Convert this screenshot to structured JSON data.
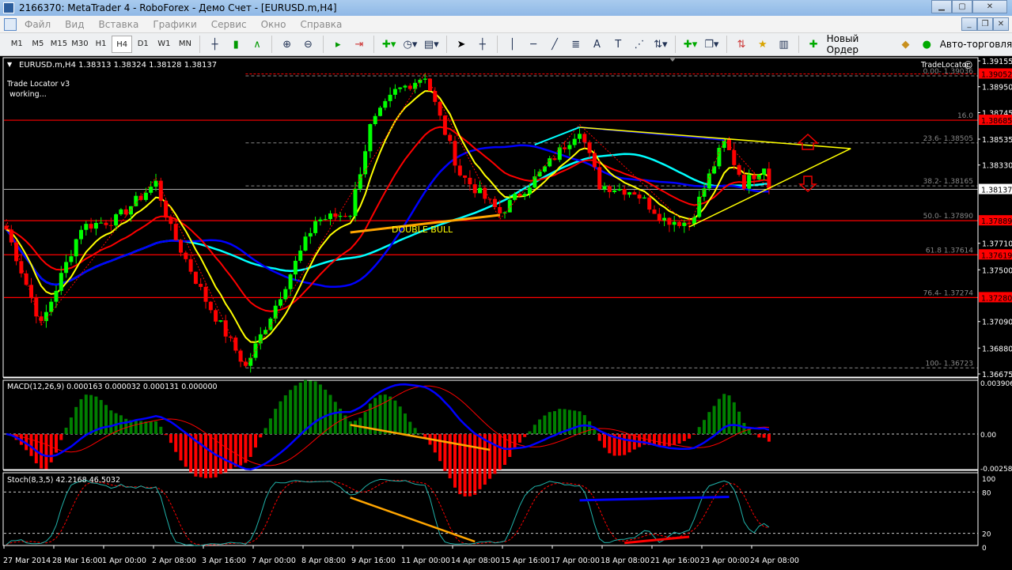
{
  "window": {
    "title": "2166370: MetaTrader 4 - RoboForex - Демо Счет - [EURUSD.m,H4]"
  },
  "menu": [
    "Файл",
    "Вид",
    "Вставка",
    "Графики",
    "Сервис",
    "Окно",
    "Справка"
  ],
  "toolbar": {
    "timeframes": [
      "M1",
      "M5",
      "M15",
      "M30",
      "H1",
      "H4",
      "D1",
      "W1",
      "MN"
    ],
    "active_timeframe": "H4",
    "new_order": "Новый Ордер",
    "autotrading": "Авто-торговля"
  },
  "chart": {
    "header": "EURUSD.m,H4  1.38313 1.38324 1.38128 1.38137",
    "indicator_name": "Trade Locator v3",
    "indicator_status": "working...",
    "tradelocator_label": "TradeLocator",
    "pattern_label": "DOUBLE BULL",
    "current_price": "1.38137",
    "price_axis": [
      "1.39155",
      "1.38950",
      "1.38745",
      "1.38535",
      "1.38330",
      "1.37710",
      "1.37500",
      "1.37090",
      "1.36880",
      "1.36675"
    ],
    "red_levels": [
      "1.39052",
      "1.38685",
      "1.37889",
      "1.37619",
      "1.37280"
    ],
    "fib_labels": [
      {
        "text": "0.00- 1.39036",
        "price": 1.39036,
        "red": false
      },
      {
        "text": "16.0",
        "price": 1.38685,
        "red": true
      },
      {
        "text": "23.6- 1.38505",
        "price": 1.38505,
        "red": false
      },
      {
        "text": "38.2- 1.38165",
        "price": 1.38165,
        "red": false
      },
      {
        "text": "50.0- 1.37890",
        "price": 1.37889,
        "red": true
      },
      {
        "text": "61.8 1.37614",
        "price": 1.37619,
        "red": true
      },
      {
        "text": "76.4- 1.37274",
        "price": 1.3728,
        "red": true
      },
      {
        "text": "100- 1.36723",
        "price": 1.36723,
        "red": false
      }
    ],
    "price_waypoints": [
      [
        0,
        1.3782
      ],
      [
        7,
        1.3706
      ],
      [
        15,
        1.3784
      ],
      [
        22,
        1.379
      ],
      [
        30,
        1.3819
      ],
      [
        33,
        1.3782
      ],
      [
        40,
        1.3726
      ],
      [
        48,
        1.3673
      ],
      [
        54,
        1.3722
      ],
      [
        62,
        1.3789
      ],
      [
        69,
        1.3795
      ],
      [
        73,
        1.3863
      ],
      [
        78,
        1.3891
      ],
      [
        84,
        1.3904
      ],
      [
        87,
        1.387
      ],
      [
        91,
        1.3826
      ],
      [
        99,
        1.3795
      ],
      [
        107,
        1.3826
      ],
      [
        115,
        1.3862
      ],
      [
        119,
        1.3817
      ],
      [
        126,
        1.3812
      ],
      [
        132,
        1.379
      ],
      [
        137,
        1.3787
      ],
      [
        144,
        1.3852
      ],
      [
        148,
        1.3818
      ],
      [
        152,
        1.3833
      ],
      [
        153,
        1.38137
      ]
    ],
    "date_labels": [
      "27 Mar 2014",
      "28 Mar 16:00",
      "1 Apr 00:00",
      "2 Apr 08:00",
      "3 Apr 16:00",
      "7 Apr 00:00",
      "8 Apr 08:00",
      "9 Apr 16:00",
      "11 Apr 00:00",
      "14 Apr 08:00",
      "15 Apr 16:00",
      "17 Apr 00:00",
      "18 Apr 08:00",
      "21 Apr 16:00",
      "23 Apr 00:00",
      "24 Apr 08:00"
    ]
  },
  "macd": {
    "header": "MACD(12,26,9) 0.000163 0.000032 0.000131 0.000000",
    "axis": [
      "0.003906",
      "0.00",
      "-0.002582"
    ]
  },
  "stoch": {
    "header": "Stoch(8,3,5) 42.2168 46.5032",
    "axis": [
      "100",
      "80",
      "20",
      "0"
    ]
  },
  "colors": {
    "bull": "#00ff00",
    "bear": "#ff0000",
    "grid_red": "#ff0000",
    "yellow": "#ffff00",
    "blue": "#0000ff",
    "cyan": "#00ffff",
    "orange": "#ffa500"
  }
}
